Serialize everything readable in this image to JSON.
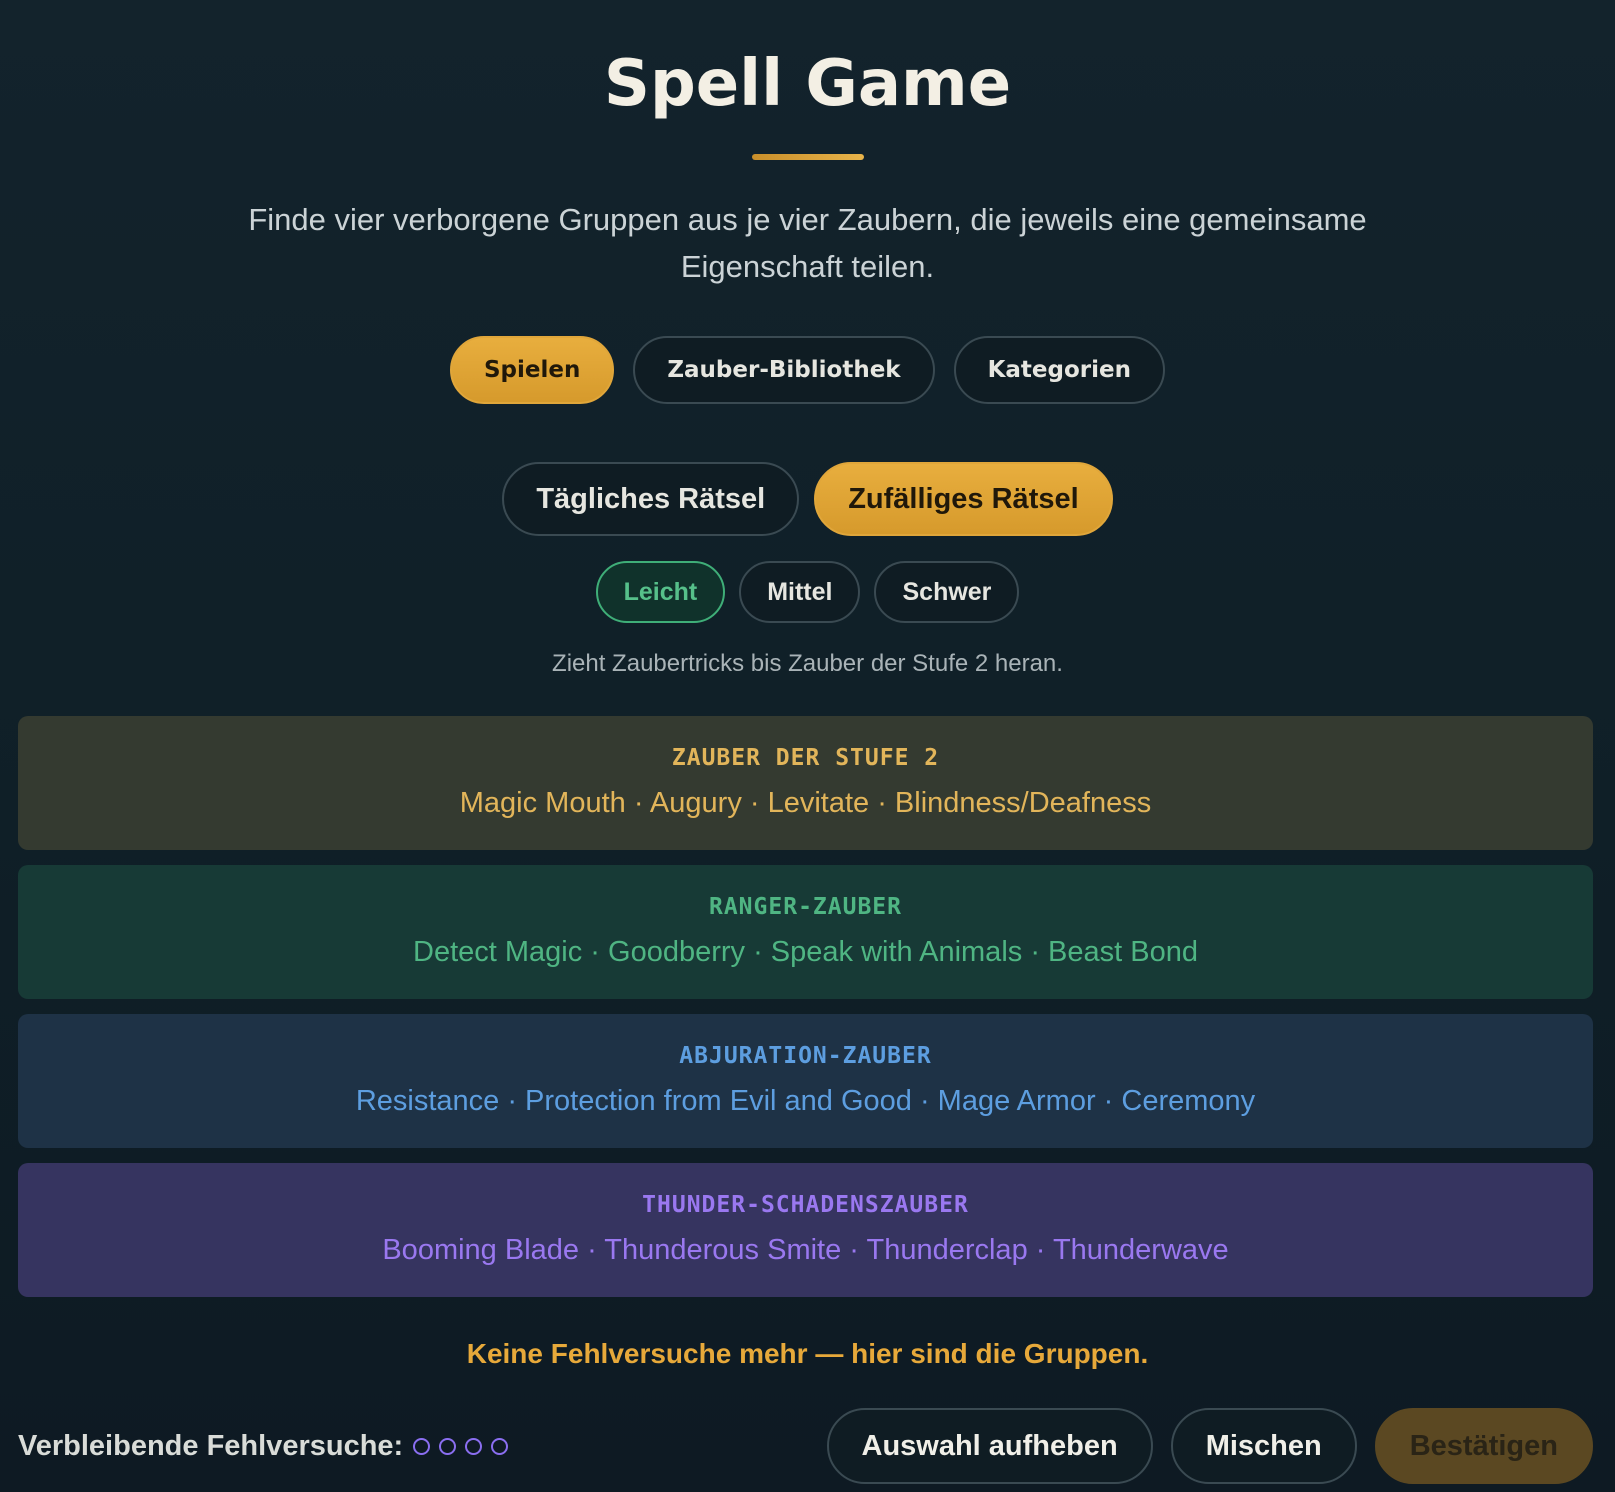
{
  "header": {
    "title": "Spell Game",
    "subtitle": "Finde vier verborgene Gruppen aus je vier Zaubern, die jeweils eine gemeinsame Eigenschaft teilen."
  },
  "nav": {
    "tabs": [
      {
        "label": "Spielen",
        "active": true
      },
      {
        "label": "Zauber-Bibliothek",
        "active": false
      },
      {
        "label": "Kategorien",
        "active": false
      }
    ]
  },
  "modes": [
    {
      "label": "Tägliches Rätsel",
      "active": false
    },
    {
      "label": "Zufälliges Rätsel",
      "active": true
    }
  ],
  "difficulty": {
    "options": [
      {
        "label": "Leicht",
        "active": true
      },
      {
        "label": "Mittel",
        "active": false
      },
      {
        "label": "Schwer",
        "active": false
      }
    ],
    "note": "Zieht Zaubertricks bis Zauber der Stufe 2 heran."
  },
  "groups": [
    {
      "title": "ZAUBER DER STUFE 2",
      "spells": "Magic Mouth · Augury · Levitate · Blindness/Deafness",
      "color": "#e2b55a"
    },
    {
      "title": "RANGER-ZAUBER",
      "spells": "Detect Magic · Goodberry · Speak with Animals · Beast Bond",
      "color": "#4fb583"
    },
    {
      "title": "ABJURATION-ZAUBER",
      "spells": "Resistance · Protection from Evil and Good · Mage Armor · Ceremony",
      "color": "#5d9ee0"
    },
    {
      "title": "THUNDER-SCHADENSZAUBER",
      "spells": "Booming Blade · Thunderous Smite · Thunderclap · Thunderwave",
      "color": "#9a78f0"
    }
  ],
  "message": "Keine Fehlversuche mehr — hier sind die Gruppen.",
  "footer": {
    "mistakes_label": "Verbleibende Fehlversuche:",
    "mistakes_remaining": 0,
    "mistakes_total": 4,
    "buttons": {
      "deselect": "Auswahl aufheben",
      "shuffle": "Mischen",
      "submit": "Bestätigen"
    }
  },
  "colors": {
    "accent": "#e0a63a",
    "easy": "#56c08a"
  }
}
